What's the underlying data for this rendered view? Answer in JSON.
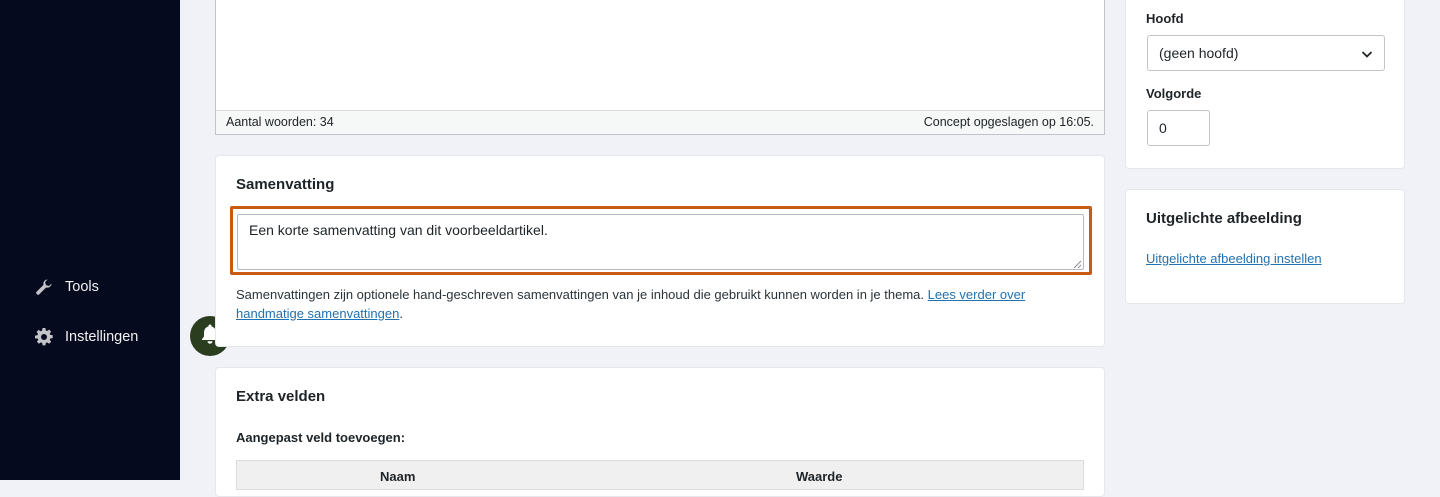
{
  "sidebar": {
    "items": [
      {
        "label": "Tools",
        "icon": "wrench-icon"
      },
      {
        "label": "Instellingen",
        "icon": "gear-icon"
      }
    ]
  },
  "editor": {
    "word_count": "Aantal woorden: 34",
    "draft_status": "Concept opgeslagen op 16:05."
  },
  "summary": {
    "title": "Samenvatting",
    "value": "Een korte samenvatting van dit voorbeeldartikel.",
    "help_text": "Samenvattingen zijn optionele hand-geschreven samenvattingen van je inhoud die gebruikt kunnen worden in je thema. ",
    "help_link": "Lees verder over handmatige samenvattingen",
    "help_end": ".",
    "highlight_color": "#c85a12"
  },
  "custom_fields": {
    "title": "Extra velden",
    "add_label": "Aangepast veld toevoegen:",
    "columns": [
      "Naam",
      "Waarde"
    ]
  },
  "attributes": {
    "parent_label": "Hoofd",
    "parent_value": "(geen hoofd)",
    "order_label": "Volgorde",
    "order_value": "0"
  },
  "featured_image": {
    "title": "Uitgelichte afbeelding",
    "link": "Uitgelichte afbeelding instellen"
  },
  "colors": {
    "sidebar_bg": "#060a1f",
    "link": "#2271b1",
    "bell_bg": "#2b3d1f"
  }
}
